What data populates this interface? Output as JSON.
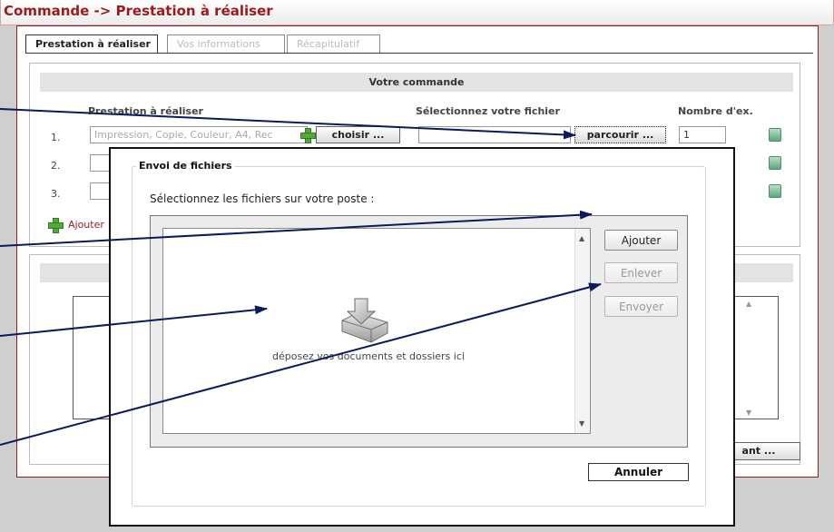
{
  "page": {
    "title": "Commande -> Prestation à réaliser",
    "tabs": [
      {
        "label": "Prestation à réaliser",
        "active": true
      },
      {
        "label": "Vos informations",
        "active": false
      },
      {
        "label": "Récapitulatif",
        "active": false
      }
    ]
  },
  "order": {
    "header": "Votre commande",
    "col_prestation": "Prestation à réaliser",
    "col_fichier": "Sélectionnez votre fichier",
    "col_nombre": "Nombre d'ex.",
    "rows": [
      {
        "num": "1.",
        "prestation": "Impression, Copie, Couleur, A4, Rec",
        "choose_label": "choisir ...",
        "browse_label": "parcourir ...",
        "quantity": "1"
      },
      {
        "num": "2."
      },
      {
        "num": "3."
      }
    ],
    "add_label": "Ajouter",
    "next_label": "ant ..."
  },
  "modal": {
    "legend": "Envoi de fichiers",
    "instruction": "Sélectionnez les fichiers sur votre poste :",
    "drop_text": "déposez vos documents et dossiers ici",
    "buttons": {
      "add": "Ajouter",
      "remove": "Enlever",
      "send": "Envoyer"
    },
    "cancel": "Annuler",
    "scroll_up": "▲",
    "scroll_down": "▼"
  },
  "colors": {
    "brand": "#9b1b1b",
    "annotation": "#0a1a5c",
    "plus": "#55a93a"
  }
}
